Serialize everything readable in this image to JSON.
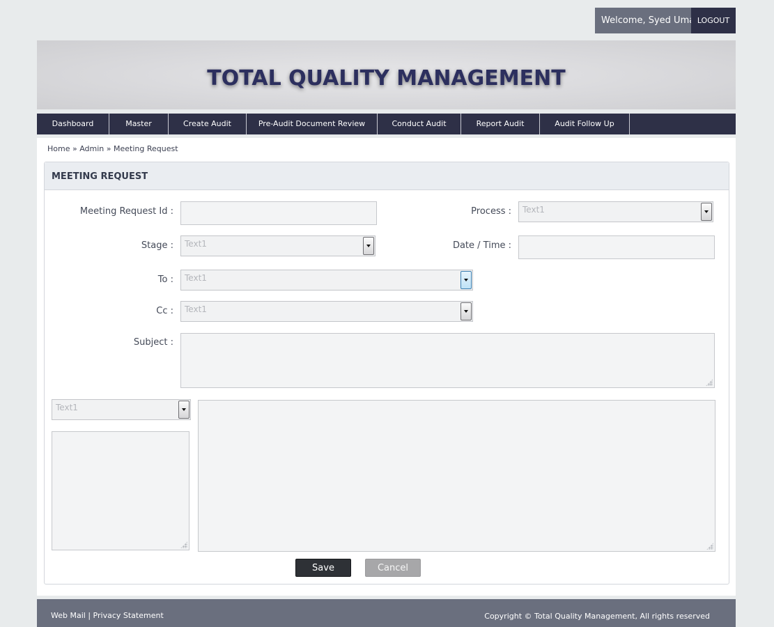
{
  "header": {
    "welcome_text": "Welcome, Syed Umar",
    "logout_label": "LOGOUT",
    "banner_title": "TOTAL QUALITY MANAGEMENT"
  },
  "nav": {
    "items": [
      {
        "label": "Dashboard"
      },
      {
        "label": "Master"
      },
      {
        "label": "Create Audit"
      },
      {
        "label": "Pre-Audit Document Review"
      },
      {
        "label": "Conduct Audit"
      },
      {
        "label": "Report Audit"
      },
      {
        "label": "Audit Follow Up"
      }
    ]
  },
  "breadcrumb": {
    "home": "Home",
    "sep": "»",
    "admin": "Admin",
    "current": "Meeting Request"
  },
  "form": {
    "title": "MEETING REQUEST",
    "meeting_request_id_label": "Meeting Request Id :",
    "meeting_request_id_value": "",
    "process_label": "Process :",
    "process_value": "Text1",
    "stage_label": "Stage :",
    "stage_value": "Text1",
    "datetime_label": "Date / Time :",
    "datetime_value": "",
    "to_label": "To :",
    "to_value": "Text1",
    "cc_label": "Cc :",
    "cc_value": "Text1",
    "subject_label": "Subject :",
    "subject_value": "",
    "list_select_value": "Text1",
    "list_box_value": "",
    "body_value": "",
    "save_label": "Save",
    "cancel_label": "Cancel"
  },
  "footer": {
    "webmail": "Web Mail",
    "divider": "|",
    "privacy": "Privacy Statement",
    "copyright": "Copyright © Total Quality Management, All rights reserved"
  },
  "colors": {
    "nav_bg": "#2e3047",
    "footer_bg": "#6a6f7e",
    "banner_title": "#2c2f5e",
    "save_button": "#2e3136",
    "cancel_button": "#a7a7a9"
  }
}
